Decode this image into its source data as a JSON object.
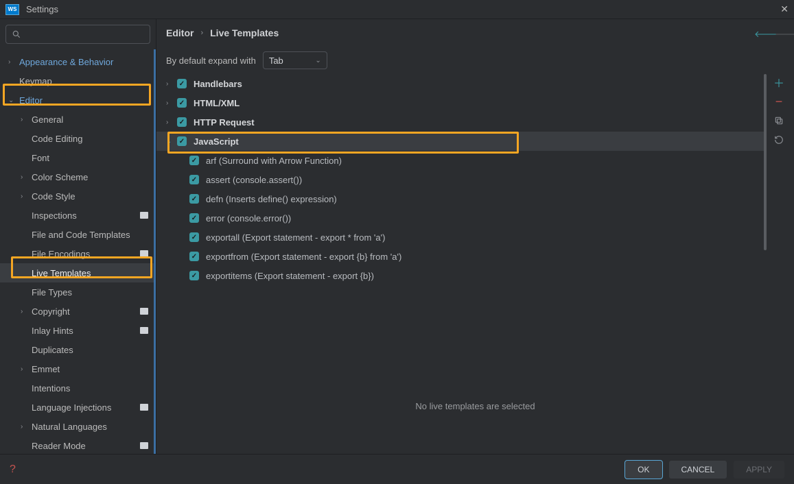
{
  "window": {
    "title": "Settings",
    "app_icon": "WS"
  },
  "breadcrumb": {
    "crumb1": "Editor",
    "crumb2": "Live Templates"
  },
  "expand": {
    "label": "By default expand with",
    "select_value": "Tab"
  },
  "sidebar": {
    "items": [
      {
        "label": "Appearance & Behavior",
        "level": 0,
        "top": true,
        "chev": "closed"
      },
      {
        "label": "Keymap",
        "level": 0
      },
      {
        "label": "Editor",
        "level": 0,
        "top": true,
        "chev": "open"
      },
      {
        "label": "General",
        "level": 1,
        "chev": "closed"
      },
      {
        "label": "Code Editing",
        "level": 1
      },
      {
        "label": "Font",
        "level": 1
      },
      {
        "label": "Color Scheme",
        "level": 1,
        "chev": "closed"
      },
      {
        "label": "Code Style",
        "level": 1,
        "chev": "closed"
      },
      {
        "label": "Inspections",
        "level": 1,
        "badge": true
      },
      {
        "label": "File and Code Templates",
        "level": 1
      },
      {
        "label": "File Encodings",
        "level": 1,
        "badge": true
      },
      {
        "label": "Live Templates",
        "level": 1,
        "selected": true
      },
      {
        "label": "File Types",
        "level": 1
      },
      {
        "label": "Copyright",
        "level": 1,
        "chev": "closed",
        "badge": true
      },
      {
        "label": "Inlay Hints",
        "level": 1,
        "badge": true
      },
      {
        "label": "Duplicates",
        "level": 1
      },
      {
        "label": "Emmet",
        "level": 1,
        "chev": "closed"
      },
      {
        "label": "Intentions",
        "level": 1
      },
      {
        "label": "Language Injections",
        "level": 1,
        "badge": true
      },
      {
        "label": "Natural Languages",
        "level": 1,
        "chev": "closed"
      },
      {
        "label": "Reader Mode",
        "level": 1,
        "badge": true
      }
    ]
  },
  "templates": {
    "groups": [
      {
        "label": "Handlebars",
        "chev": "closed",
        "checked": true
      },
      {
        "label": "HTML/XML",
        "chev": "closed",
        "checked": true
      },
      {
        "label": "HTTP Request",
        "chev": "closed",
        "checked": true
      },
      {
        "label": "JavaScript",
        "chev": "open",
        "checked": true,
        "selected": true,
        "items": [
          {
            "label": "arf (Surround with Arrow Function)"
          },
          {
            "label": "assert (console.assert())"
          },
          {
            "label": "defn (Inserts define() expression)"
          },
          {
            "label": "error (console.error())"
          },
          {
            "label": "exportall (Export statement - export * from 'a')"
          },
          {
            "label": "exportfrom (Export statement - export {b} from 'a')"
          },
          {
            "label": "exportitems (Export statement - export {b})"
          }
        ]
      }
    ]
  },
  "detail": {
    "empty_text": "No live templates are selected"
  },
  "buttons": {
    "ok": "OK",
    "cancel": "CANCEL",
    "apply": "APPLY"
  }
}
